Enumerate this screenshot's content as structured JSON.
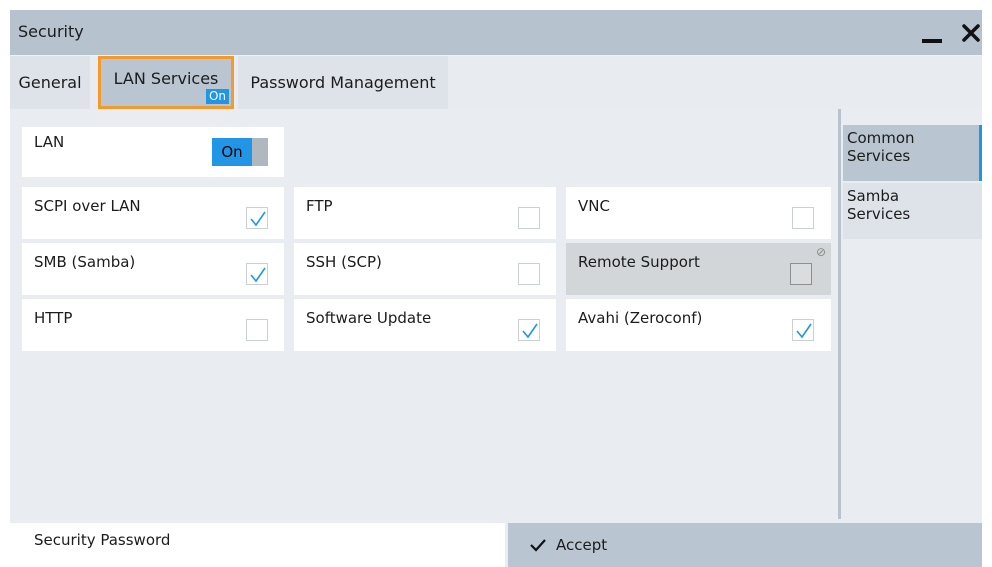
{
  "window": {
    "title": "Security"
  },
  "tabs": [
    {
      "label": "General",
      "active": false
    },
    {
      "label": "LAN Services",
      "badge": "On",
      "active": true
    },
    {
      "label": "Password Management",
      "active": false
    }
  ],
  "lan": {
    "label": "LAN",
    "toggle_state": "On"
  },
  "services": [
    {
      "label": "SCPI over LAN",
      "checked": true
    },
    {
      "label": "FTP",
      "checked": false
    },
    {
      "label": "VNC",
      "checked": false
    },
    {
      "label": "SMB (Samba)",
      "checked": true
    },
    {
      "label": "SSH (SCP)",
      "checked": false
    },
    {
      "label": "Remote Support",
      "checked": false,
      "disabled": true
    },
    {
      "label": "HTTP",
      "checked": false
    },
    {
      "label": "Software Update",
      "checked": true
    },
    {
      "label": "Avahi (Zeroconf)",
      "checked": true
    }
  ],
  "sidenav": [
    {
      "label": "Common Services",
      "line1": "Common",
      "line2": "Services",
      "active": true
    },
    {
      "label": "Samba Services",
      "line1": "Samba",
      "line2": "Services",
      "active": false
    }
  ],
  "bottom": {
    "password_label": "Security Password",
    "accept_label": "Accept"
  },
  "colors": {
    "accent_blue": "#2196e6",
    "active_tab_border": "#f29a2e",
    "titlebar": "#b6c2cd"
  },
  "icons": {
    "minimize": "minimize-icon",
    "close": "close-icon",
    "check": "check-icon",
    "blocked": "blocked-icon",
    "accept": "checkmark-icon"
  }
}
